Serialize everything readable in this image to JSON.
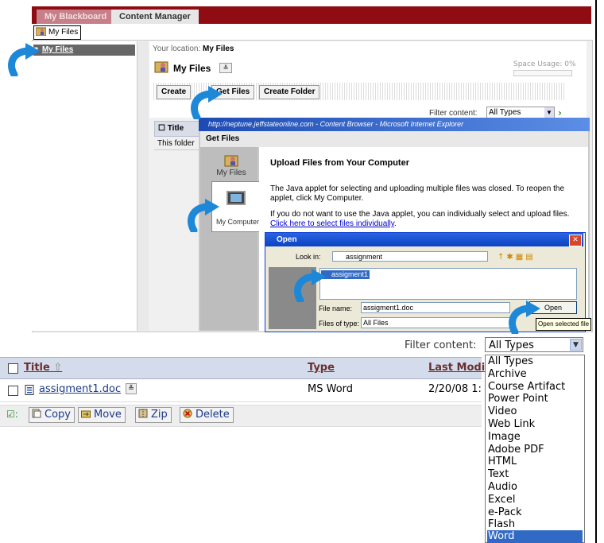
{
  "top_tabs": {
    "inactive": "My Blackboard",
    "active": "Content Manager"
  },
  "breadcrumb": "My Files",
  "nav": {
    "item": "My Files"
  },
  "content_manager": {
    "location_label": "Your location:",
    "location_value": "My Files",
    "heading": "My Files",
    "space_usage": "Space Usage: 0%",
    "buttons": [
      "Create",
      "Get Files",
      "Create Folder"
    ],
    "filter_label": "Filter content:",
    "filter_value": "All Types",
    "title_header": "Title",
    "empty_text": "This folder"
  },
  "browser_window": {
    "title": "http://neptune.jeffstateonline.com - Content Browser - Microsoft Internet Explorer",
    "heading": "Get Files",
    "nav_my_files": "My Files",
    "nav_my_computer": "My Computer",
    "upload_title": "Upload Files from Your Computer",
    "para1": "The Java applet for selecting and uploading multiple files was closed. To reopen the applet, click My Computer.",
    "para2_prefix": "If you do not want to use the Java applet, you can individually select and upload files.",
    "para2_link": "Click here to select files individually"
  },
  "open_dialog": {
    "title": "Open",
    "look_in_label": "Look in:",
    "look_in_value": "assignment",
    "file_item": "assigment1",
    "file_name_label": "File name:",
    "file_name_value": "assigment1.doc",
    "file_type_label": "Files of type:",
    "file_type_value": "All Files",
    "open_button": "Open",
    "tooltip": "Open selected file"
  },
  "list": {
    "filter_label": "Filter content:",
    "filter_value": "All Types",
    "headers": {
      "title": "Title",
      "type": "Type",
      "modified": "Last Modi"
    },
    "rows": [
      {
        "title": "assigment1.doc",
        "type": "MS Word",
        "modified": "2/20/08 1:"
      }
    ],
    "actions": [
      "Copy",
      "Move",
      "Zip",
      "Delete"
    ]
  },
  "filter_options": [
    "All Types",
    "Archive",
    "Course Artifact",
    "Power Point",
    "Video",
    "Web Link",
    "Image",
    "Adobe PDF",
    "HTML",
    "Text",
    "Audio",
    "Excel",
    "e-Pack",
    "Flash",
    "Word"
  ],
  "selected_filter_option": "Word",
  "colors": {
    "brand": "#8f0d12",
    "arrow": "#1e88d8",
    "selection": "#316ac5",
    "link": "#1a3a8a"
  }
}
